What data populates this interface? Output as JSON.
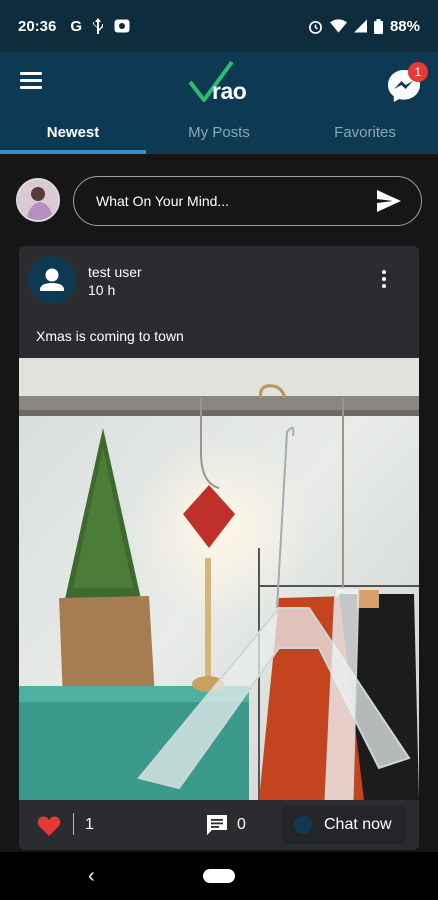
{
  "status_bar": {
    "time": "20:36",
    "icons": [
      "google-icon",
      "usb-icon",
      "notification-icon"
    ],
    "right_icons": [
      "alarm-icon",
      "wifi-icon",
      "signal-icon",
      "battery-icon"
    ],
    "battery": "88%"
  },
  "app_bar": {
    "menu_icon": "hamburger-menu-icon",
    "logo_text": "rao",
    "messenger_icon": "messenger-icon",
    "messenger_badge": "1"
  },
  "tabs": [
    {
      "label": "Newest",
      "active": true
    },
    {
      "label": "My Posts",
      "active": false
    },
    {
      "label": "Favorites",
      "active": false
    }
  ],
  "composer": {
    "placeholder": "What On Your Mind...",
    "send_icon": "send-icon"
  },
  "post": {
    "user": "test user",
    "time": "10 h",
    "caption": "Xmas is coming to town",
    "like_count": "1",
    "comment_count": "0",
    "chat_label": "Chat now"
  },
  "colors": {
    "app_bar": "#0d3a52",
    "tab_indicator": "#3a8fc4",
    "like": "#e53935",
    "badge": "#e53935",
    "background": "#161616",
    "card": "#2b2c2f"
  }
}
